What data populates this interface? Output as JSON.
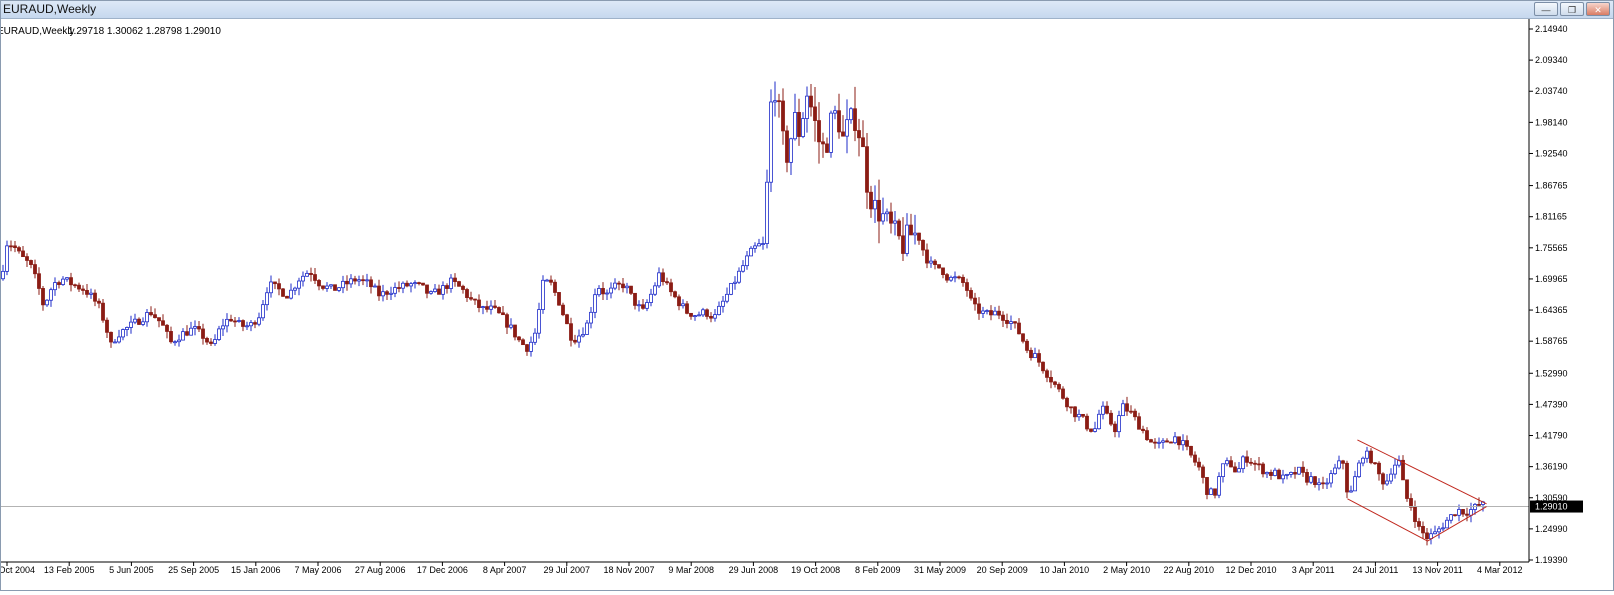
{
  "window": {
    "title": "EURAUD,Weekly",
    "buttons": {
      "minimize": "—",
      "restore": "❐",
      "close": "✕"
    }
  },
  "chart_info": {
    "symbol_label": "EURAUD,Weekly",
    "ohlc": "1.29718 1.30062 1.28798 1.29010"
  },
  "colors": {
    "bull": "#1d2bc9",
    "bear": "#8b1c14",
    "trend": "#c0271d",
    "current_line": "#b3b3b3",
    "axis": "#000000"
  },
  "chart_data": {
    "type": "candlestick",
    "title": "",
    "ylim": [
      1.1939,
      2.1494
    ],
    "y_ticks": [
      "2.14940",
      "2.09340",
      "2.03740",
      "1.98140",
      "1.92540",
      "1.86765",
      "1.81165",
      "1.75565",
      "1.69965",
      "1.64365",
      "1.58765",
      "1.52990",
      "1.47390",
      "1.41790",
      "1.36190",
      "1.30590",
      "1.24990",
      "1.19390"
    ],
    "x_labels": [
      "Oct 2004",
      "13 Feb 2005",
      "5 Jun 2005",
      "25 Sep 2005",
      "15 Jan 2006",
      "7 May 2006",
      "27 Aug 2006",
      "17 Dec 2006",
      "8 Apr 2007",
      "29 Jul 2007",
      "18 Nov 2007",
      "9 Mar 2008",
      "29 Jun 2008",
      "19 Oct 2008",
      "8 Feb 2009",
      "31 May 2009",
      "20 Sep 2009",
      "10 Jan 2010",
      "2 May 2010",
      "22 Aug 2010",
      "12 Dec 2010",
      "3 Apr 2011",
      "24 Jul 2011",
      "13 Nov 2011",
      "4 Mar 2012"
    ],
    "current_price": 1.2901,
    "current_price_label": "1.29010",
    "trend_channel": {
      "upper": [
        [
          0.8877,
          1.41
        ],
        [
          0.9722,
          1.295
        ]
      ],
      "lower": [
        [
          0.8812,
          1.304
        ],
        [
          0.9336,
          1.228
        ],
        [
          0.9722,
          1.29
        ]
      ]
    },
    "close_path": [
      [
        0.0,
        1.7
      ],
      [
        0.004,
        1.765
      ],
      [
        0.008,
        1.76
      ],
      [
        0.013,
        1.74
      ],
      [
        0.019,
        1.725
      ],
      [
        0.024,
        1.69
      ],
      [
        0.028,
        1.65
      ],
      [
        0.034,
        1.69
      ],
      [
        0.04,
        1.7
      ],
      [
        0.047,
        1.69
      ],
      [
        0.055,
        1.68
      ],
      [
        0.06,
        1.665
      ],
      [
        0.064,
        1.65
      ],
      [
        0.068,
        1.62
      ],
      [
        0.072,
        1.58
      ],
      [
        0.076,
        1.6
      ],
      [
        0.082,
        1.61
      ],
      [
        0.09,
        1.625
      ],
      [
        0.098,
        1.64
      ],
      [
        0.105,
        1.62
      ],
      [
        0.111,
        1.585
      ],
      [
        0.118,
        1.6
      ],
      [
        0.126,
        1.61
      ],
      [
        0.133,
        1.595
      ],
      [
        0.138,
        1.575
      ],
      [
        0.144,
        1.615
      ],
      [
        0.15,
        1.63
      ],
      [
        0.157,
        1.615
      ],
      [
        0.163,
        1.615
      ],
      [
        0.169,
        1.635
      ],
      [
        0.175,
        1.69
      ],
      [
        0.182,
        1.68
      ],
      [
        0.188,
        1.67
      ],
      [
        0.195,
        1.7
      ],
      [
        0.202,
        1.715
      ],
      [
        0.209,
        1.69
      ],
      [
        0.217,
        1.68
      ],
      [
        0.225,
        1.69
      ],
      [
        0.233,
        1.7
      ],
      [
        0.241,
        1.69
      ],
      [
        0.248,
        1.67
      ],
      [
        0.255,
        1.68
      ],
      [
        0.262,
        1.685
      ],
      [
        0.268,
        1.69
      ],
      [
        0.275,
        1.685
      ],
      [
        0.281,
        1.67
      ],
      [
        0.288,
        1.68
      ],
      [
        0.295,
        1.695
      ],
      [
        0.302,
        1.68
      ],
      [
        0.308,
        1.66
      ],
      [
        0.315,
        1.645
      ],
      [
        0.322,
        1.645
      ],
      [
        0.328,
        1.63
      ],
      [
        0.334,
        1.61
      ],
      [
        0.34,
        1.585
      ],
      [
        0.345,
        1.575
      ],
      [
        0.35,
        1.605
      ],
      [
        0.355,
        1.695
      ],
      [
        0.36,
        1.69
      ],
      [
        0.365,
        1.66
      ],
      [
        0.37,
        1.62
      ],
      [
        0.374,
        1.59
      ],
      [
        0.379,
        1.6
      ],
      [
        0.384,
        1.62
      ],
      [
        0.39,
        1.69
      ],
      [
        0.396,
        1.67
      ],
      [
        0.402,
        1.685
      ],
      [
        0.408,
        1.69
      ],
      [
        0.414,
        1.66
      ],
      [
        0.42,
        1.64
      ],
      [
        0.426,
        1.675
      ],
      [
        0.431,
        1.71
      ],
      [
        0.437,
        1.68
      ],
      [
        0.443,
        1.66
      ],
      [
        0.449,
        1.64
      ],
      [
        0.455,
        1.635
      ],
      [
        0.461,
        1.64
      ],
      [
        0.467,
        1.63
      ],
      [
        0.473,
        1.66
      ],
      [
        0.479,
        1.69
      ],
      [
        0.485,
        1.72
      ],
      [
        0.49,
        1.745
      ],
      [
        0.495,
        1.76
      ],
      [
        0.5,
        1.76
      ],
      [
        0.503,
        2.0
      ],
      [
        0.507,
        2.05
      ],
      [
        0.511,
        1.95
      ],
      [
        0.515,
        1.92
      ],
      [
        0.519,
        1.99
      ],
      [
        0.523,
        1.96
      ],
      [
        0.527,
        2.04
      ],
      [
        0.531,
        2.0
      ],
      [
        0.535,
        1.95
      ],
      [
        0.539,
        1.93
      ],
      [
        0.543,
        1.98
      ],
      [
        0.547,
        2.0
      ],
      [
        0.551,
        1.95
      ],
      [
        0.555,
        1.98
      ],
      [
        0.559,
        1.99
      ],
      [
        0.563,
        1.95
      ],
      [
        0.567,
        1.87
      ],
      [
        0.571,
        1.83
      ],
      [
        0.575,
        1.82
      ],
      [
        0.58,
        1.8
      ],
      [
        0.585,
        1.78
      ],
      [
        0.59,
        1.76
      ],
      [
        0.595,
        1.78
      ],
      [
        0.6,
        1.78
      ],
      [
        0.605,
        1.74
      ],
      [
        0.61,
        1.72
      ],
      [
        0.615,
        1.72
      ],
      [
        0.62,
        1.7
      ],
      [
        0.625,
        1.7
      ],
      [
        0.631,
        1.69
      ],
      [
        0.636,
        1.65
      ],
      [
        0.641,
        1.64
      ],
      [
        0.647,
        1.635
      ],
      [
        0.652,
        1.64
      ],
      [
        0.657,
        1.63
      ],
      [
        0.662,
        1.62
      ],
      [
        0.667,
        1.6
      ],
      [
        0.672,
        1.57
      ],
      [
        0.677,
        1.56
      ],
      [
        0.682,
        1.54
      ],
      [
        0.687,
        1.52
      ],
      [
        0.692,
        1.5
      ],
      [
        0.697,
        1.48
      ],
      [
        0.702,
        1.46
      ],
      [
        0.707,
        1.45
      ],
      [
        0.712,
        1.43
      ],
      [
        0.716,
        1.43
      ],
      [
        0.72,
        1.47
      ],
      [
        0.724,
        1.45
      ],
      [
        0.729,
        1.43
      ],
      [
        0.734,
        1.47
      ],
      [
        0.739,
        1.46
      ],
      [
        0.744,
        1.44
      ],
      [
        0.749,
        1.42
      ],
      [
        0.754,
        1.4
      ],
      [
        0.759,
        1.4
      ],
      [
        0.764,
        1.41
      ],
      [
        0.769,
        1.415
      ],
      [
        0.774,
        1.4
      ],
      [
        0.779,
        1.38
      ],
      [
        0.784,
        1.36
      ],
      [
        0.789,
        1.32
      ],
      [
        0.794,
        1.31
      ],
      [
        0.799,
        1.36
      ],
      [
        0.804,
        1.37
      ],
      [
        0.809,
        1.35
      ],
      [
        0.814,
        1.38
      ],
      [
        0.819,
        1.37
      ],
      [
        0.824,
        1.36
      ],
      [
        0.829,
        1.35
      ],
      [
        0.834,
        1.35
      ],
      [
        0.839,
        1.34
      ],
      [
        0.844,
        1.345
      ],
      [
        0.849,
        1.355
      ],
      [
        0.854,
        1.34
      ],
      [
        0.859,
        1.34
      ],
      [
        0.864,
        1.32
      ],
      [
        0.869,
        1.34
      ],
      [
        0.874,
        1.36
      ],
      [
        0.878,
        1.375
      ],
      [
        0.882,
        1.3
      ],
      [
        0.886,
        1.34
      ],
      [
        0.891,
        1.385
      ],
      [
        0.896,
        1.38
      ],
      [
        0.901,
        1.35
      ],
      [
        0.906,
        1.33
      ],
      [
        0.911,
        1.365
      ],
      [
        0.915,
        1.37
      ],
      [
        0.919,
        1.31
      ],
      [
        0.923,
        1.29
      ],
      [
        0.928,
        1.25
      ],
      [
        0.933,
        1.235
      ],
      [
        0.938,
        1.24
      ],
      [
        0.943,
        1.255
      ],
      [
        0.948,
        1.27
      ],
      [
        0.953,
        1.285
      ],
      [
        0.958,
        1.28
      ],
      [
        0.963,
        1.285
      ],
      [
        0.968,
        1.295
      ],
      [
        0.972,
        1.29
      ]
    ]
  }
}
